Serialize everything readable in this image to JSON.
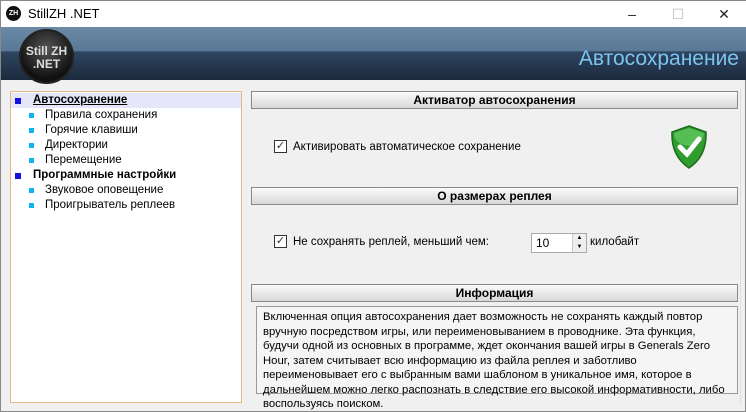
{
  "window": {
    "title": "StillZH .NET",
    "icon_text": "ZH",
    "minimize": "–",
    "maximize": "☐",
    "close": "✕"
  },
  "header": {
    "logo_line1": "Still ZH",
    "logo_line2": ".NET",
    "title": "Автосохранение"
  },
  "tree": {
    "items": [
      {
        "label": "Автосохранение",
        "level": 1,
        "selected": true
      },
      {
        "label": "Правила сохранения",
        "level": 2
      },
      {
        "label": "Горячие клавиши",
        "level": 2
      },
      {
        "label": "Директории",
        "level": 2
      },
      {
        "label": "Перемещение",
        "level": 2
      },
      {
        "label": "Программные настройки",
        "level": 1
      },
      {
        "label": "Звуковое оповещение",
        "level": 2
      },
      {
        "label": "Проигрыватель реплеев",
        "level": 2
      }
    ]
  },
  "sections": {
    "activator": {
      "title": "Активатор автосохранения",
      "checkbox_label": "Активировать автоматическое сохранение",
      "checked": true
    },
    "size": {
      "title": "О размерах реплея",
      "checkbox_label": "Не сохранять реплей, меньший чем:",
      "checked": true,
      "value": "10",
      "unit": "килобайт"
    },
    "info": {
      "title": "Информация",
      "text": "Включенная опция автосохранения дает возможность не сохранять каждый повтор вручную посредством игры, или переименовыванием в проводнике. Эта функция, будучи одной из основных в программе, ждет окончания вашей игры в Generals Zero Hour, затем считывает всю информацию из файла реплея и заботливо переименовывает его с выбранным вами шаблоном в уникальное имя, которое в дальнейшем можно легко распознать в следствие его высокой информативности, либо воспользуясь поиском."
    }
  }
}
